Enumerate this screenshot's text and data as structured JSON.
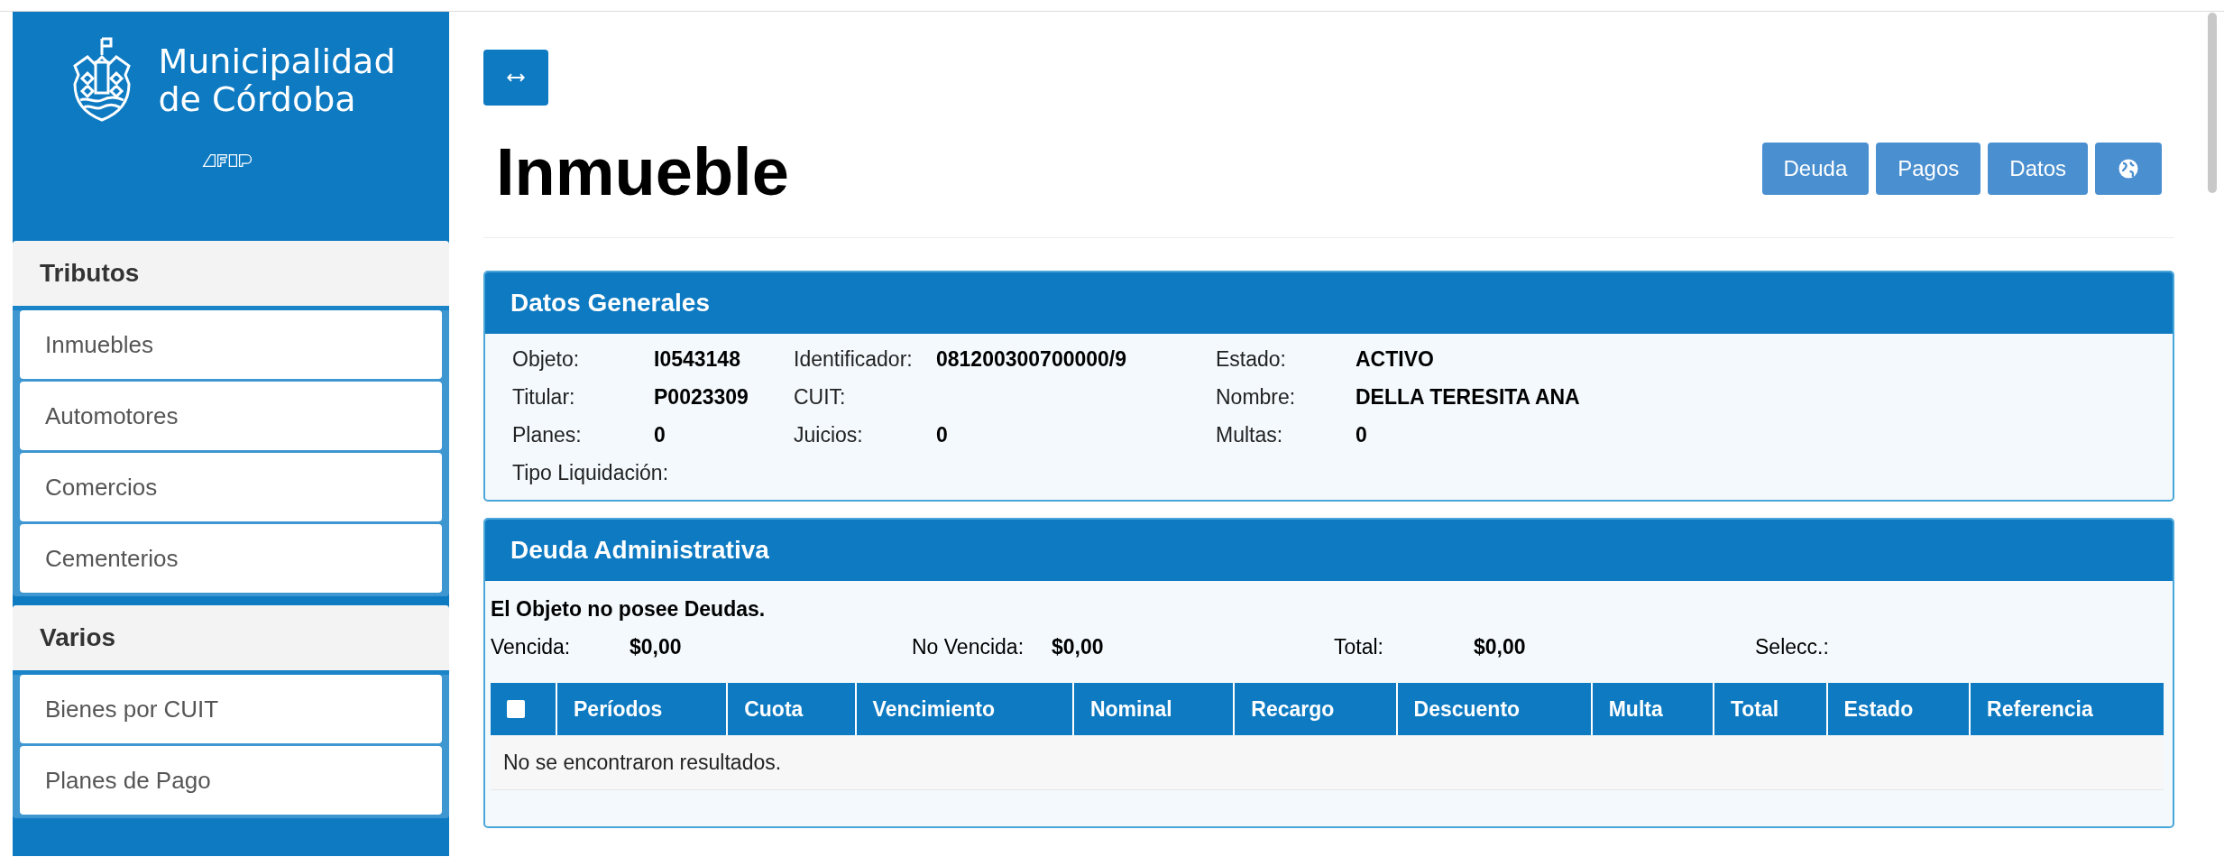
{
  "sidebar": {
    "brand": {
      "line_1": "Municipalidad",
      "line_2": "de Córdoba"
    },
    "sections": [
      {
        "title": "Tributos",
        "items": [
          {
            "label": "Inmuebles"
          },
          {
            "label": "Automotores"
          },
          {
            "label": "Comercios"
          },
          {
            "label": "Cementerios"
          }
        ]
      },
      {
        "title": "Varios",
        "items": [
          {
            "label": "Bienes por CUIT"
          },
          {
            "label": "Planes de Pago"
          }
        ]
      }
    ]
  },
  "header": {
    "title": "Inmueble",
    "buttons": [
      {
        "kind": "text",
        "label": "Deuda"
      },
      {
        "kind": "text",
        "label": "Pagos"
      },
      {
        "kind": "text",
        "label": "Datos"
      },
      {
        "kind": "globe"
      }
    ]
  },
  "datos_generales": {
    "title": "Datos Generales",
    "rows": [
      [
        {
          "label": "Objeto:",
          "value": "I0543148"
        },
        {
          "label": "Identificador:",
          "value": "081200300700000/9"
        },
        {
          "label": "Estado:",
          "value": "ACTIVO"
        }
      ],
      [
        {
          "label": "Titular:",
          "value": "P0023309"
        },
        {
          "label": "CUIT:"
        },
        {
          "label": "Nombre:",
          "value": "DELLA TERESITA ANA"
        }
      ],
      [
        {
          "label": "Planes:",
          "value": "0"
        },
        {
          "label": "Juicios:",
          "value": "0"
        },
        {
          "label": "Multas:",
          "value": "0"
        }
      ],
      [
        {
          "label": "Tipo Liquidación:"
        }
      ]
    ]
  },
  "deuda_administrativa": {
    "title": "Deuda Administrativa",
    "message": "El Objeto no posee Deudas.",
    "totals": [
      {
        "label": "Vencida:",
        "value": "$0,00"
      },
      {
        "label": "No Vencida:",
        "value": "$0,00"
      },
      {
        "label": "Total:",
        "value": "$0,00"
      },
      {
        "label": "Selecc.:"
      }
    ],
    "table": {
      "select_all": {
        "checked": false
      },
      "columns": [
        "Períodos",
        "Cuota",
        "Vencimiento",
        "Nominal",
        "Recargo",
        "Descuento",
        "Multa",
        "Total",
        "Estado",
        "Referencia"
      ],
      "empty_message": "No se encontraron resultados."
    }
  }
}
